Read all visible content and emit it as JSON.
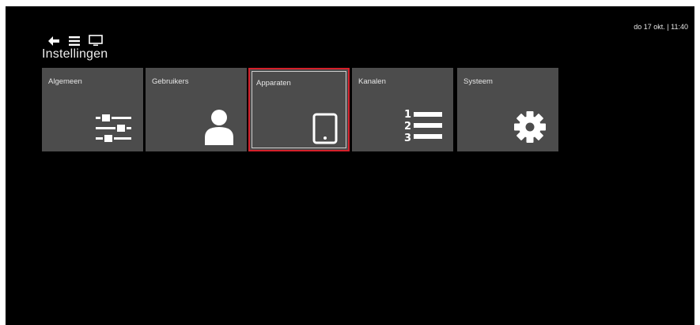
{
  "header": {
    "title": "Instellingen",
    "datetime": "do 17 okt. | 11:40",
    "icons": [
      "back-arrow-icon",
      "menu-icon",
      "tv-icon"
    ]
  },
  "tiles": [
    {
      "label": "Algemeen",
      "icon": "sliders-icon",
      "selected": false
    },
    {
      "label": "Gebruikers",
      "icon": "user-icon",
      "selected": false
    },
    {
      "label": "Apparaten",
      "icon": "tablet-icon",
      "selected": true
    },
    {
      "label": "Kanalen",
      "icon": "numbered-list-icon",
      "selected": false
    },
    {
      "label": "Systeem",
      "icon": "gear-icon",
      "selected": false
    }
  ],
  "colors": {
    "background": "#000000",
    "tile": "#4c4c4c",
    "selection": "#d4202a",
    "text": "#e6e6e6"
  }
}
